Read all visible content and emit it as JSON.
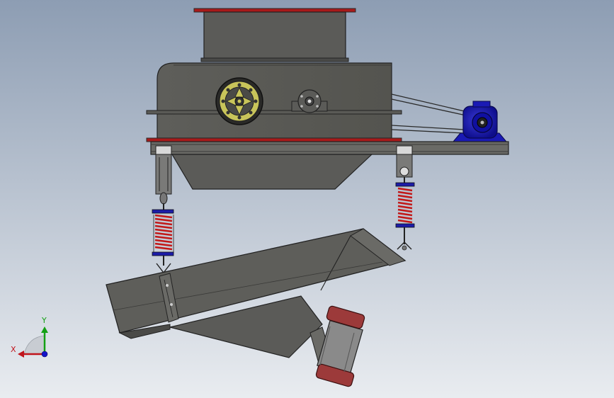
{
  "triad": {
    "x_label": "X",
    "y_label": "Y",
    "x_color": "#c0141c",
    "y_color": "#14a014",
    "z_color": "#1414c8"
  },
  "colors": {
    "background_top": "#8d9db3",
    "background_bottom": "#e7eaef",
    "machine_body": "#5b5b58",
    "machine_dark": "#3c3c3a",
    "flange_red": "#a81a1a",
    "motor_blue": "#1a1ab4",
    "spring_red": "#c21818",
    "wheel_yellow": "#c8c45a",
    "roller_red": "#9c3a3a",
    "roller_grey": "#8a8a8a"
  }
}
